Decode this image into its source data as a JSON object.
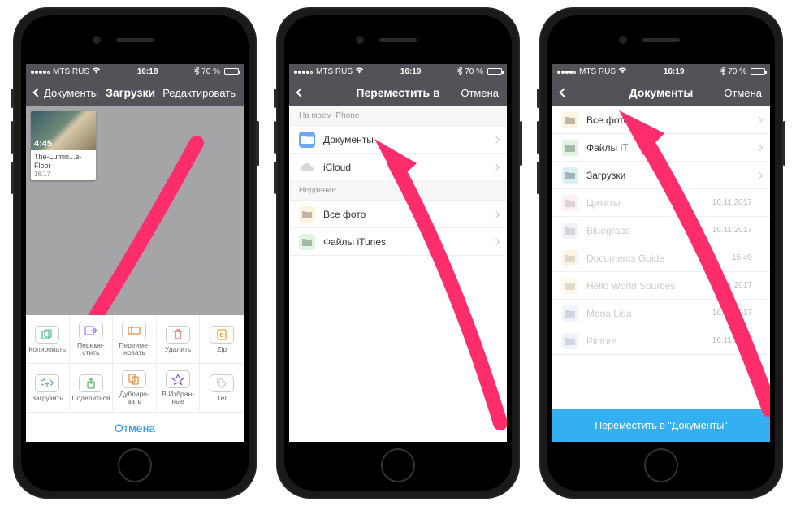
{
  "status": {
    "carrier": "MTS RUS",
    "wifi_icon": "wifi",
    "bt_icon": "bt",
    "battery_pct": "70 %",
    "times": [
      "16:18",
      "16:19",
      "16:19"
    ]
  },
  "phone1": {
    "header": {
      "back": "Документы",
      "title": "Загрузки",
      "right": "Редактировать"
    },
    "thumb": {
      "duration": "4:45",
      "filename": "The-Lumin...e-Floor",
      "time": "16:17"
    },
    "sheet": {
      "row1": [
        {
          "label": "Копировать",
          "icon": "copy",
          "tint": "#5fbfa0"
        },
        {
          "label": "Переме-\nстить",
          "icon": "move",
          "tint": "#a57cf0"
        },
        {
          "label": "Переиме-\nновать",
          "icon": "rename",
          "tint": "#f08a3c"
        },
        {
          "label": "Удалить",
          "icon": "trash",
          "tint": "#e86060"
        },
        {
          "label": "Zip",
          "icon": "zip",
          "tint": "#f0a030"
        }
      ],
      "row2": [
        {
          "label": "Загрузить",
          "icon": "upload",
          "tint": "#7aa0c8"
        },
        {
          "label": "Поделиться",
          "icon": "share",
          "tint": "#5fbf60"
        },
        {
          "label": "Дублиро-\nвать",
          "icon": "dup",
          "tint": "#f08a3c"
        },
        {
          "label": "В Избран-\nные",
          "icon": "star",
          "tint": "#8a60d0"
        },
        {
          "label": "Тег",
          "icon": "tag",
          "tint": "#c8c8c8"
        }
      ],
      "cancel": "Отмена"
    }
  },
  "phone2": {
    "header": {
      "title": "Переместить в",
      "right": "Отмена"
    },
    "section1": {
      "label": "На моем iPhone",
      "items": [
        {
          "label": "Документы",
          "icon": "folder-blue"
        },
        {
          "label": "iCloud",
          "icon": "cloud"
        }
      ]
    },
    "section2": {
      "label": "Недавние",
      "items": [
        {
          "label": "Все фото",
          "icon": "dot-orange"
        },
        {
          "label": "Файлы iTunes",
          "icon": "dot-green"
        }
      ]
    }
  },
  "phone3": {
    "header": {
      "title": "Документы",
      "right": "Отмена"
    },
    "items": [
      {
        "label": "Все фото",
        "icon": "dot-orange",
        "meta": "",
        "chev": true,
        "muted": false
      },
      {
        "label": "Файлы iT",
        "icon": "dot-green",
        "meta": "",
        "chev": true,
        "muted": false
      },
      {
        "label": "Загрузки",
        "icon": "dot-cyan",
        "meta": "",
        "chev": true,
        "muted": false
      },
      {
        "label": "Цитаты",
        "icon": "dot-pink",
        "meta": "16.11.2017",
        "chev": false,
        "muted": true
      },
      {
        "label": "Bluegrass",
        "icon": "dot-lav",
        "meta": "16.11.2017",
        "chev": false,
        "muted": true
      },
      {
        "label": "Documents Guide",
        "icon": "dot-orange2",
        "meta": "15:49",
        "chev": false,
        "muted": true
      },
      {
        "label": "Hello World Sources",
        "icon": "dot-yellow",
        "meta": "16.11.2017",
        "chev": false,
        "muted": true
      },
      {
        "label": "Mona Lisa",
        "icon": "dot-blue2",
        "meta": "16.11.2017",
        "chev": false,
        "muted": true
      },
      {
        "label": "Picture",
        "icon": "dot-blue2",
        "meta": "16.11.2017",
        "chev": false,
        "muted": true
      }
    ],
    "cta": "Переместить в \"Документы\""
  }
}
